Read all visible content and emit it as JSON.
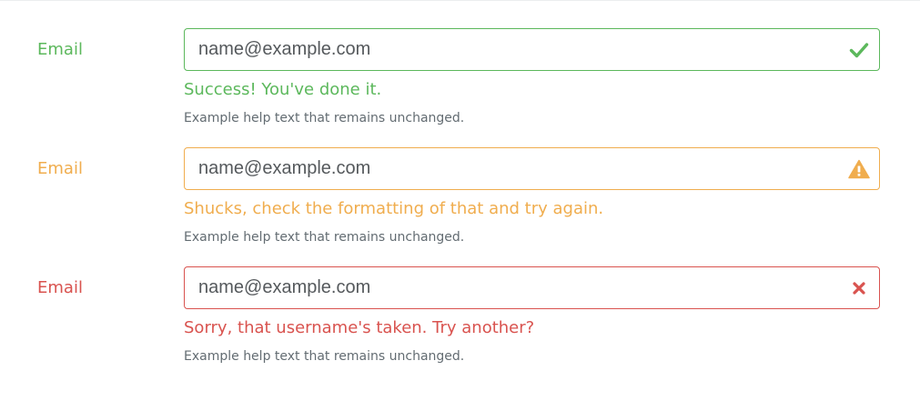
{
  "colors": {
    "success": "#5cb85c",
    "warning": "#f0ad4e",
    "danger": "#d9534f",
    "help_text": "#636c72",
    "input_text": "#55595c"
  },
  "fields": [
    {
      "state": "success",
      "label": "Email",
      "placeholder": "name@example.com",
      "icon": "check-icon",
      "feedback": "Success! You've done it.",
      "help": "Example help text that remains unchanged."
    },
    {
      "state": "warning",
      "label": "Email",
      "placeholder": "name@example.com",
      "icon": "warning-icon",
      "feedback": "Shucks, check the formatting of that and try again.",
      "help": "Example help text that remains unchanged."
    },
    {
      "state": "danger",
      "label": "Email",
      "placeholder": "name@example.com",
      "icon": "close-icon",
      "feedback": "Sorry, that username's taken. Try another?",
      "help": "Example help text that remains unchanged."
    }
  ]
}
